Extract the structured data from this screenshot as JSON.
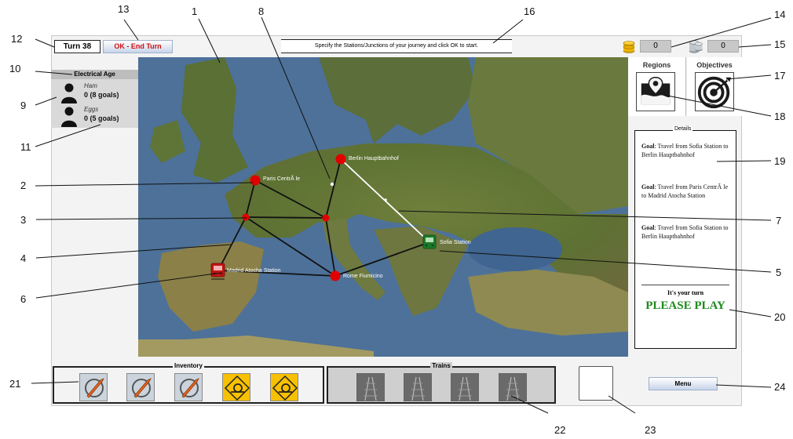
{
  "header": {
    "turn": "Turn 38",
    "end_turn_label": "OK - End Turn",
    "instruction": "Specify the Stations/Junctions of your journey and click OK to start.",
    "coins": "0",
    "tokens": "0"
  },
  "players_panel": {
    "age": "Electrical Age",
    "players": [
      {
        "name": "Ham",
        "score": "0 (8 goals)"
      },
      {
        "name": "Eggs",
        "score": "0 (5 goals)"
      }
    ]
  },
  "map": {
    "stations": [
      {
        "label": "Berlin Hauptbahnhof"
      },
      {
        "label": "Paris CentrÃ le"
      },
      {
        "label": "Sofia Station"
      },
      {
        "label": "Madrid Atocha Station"
      },
      {
        "label": "Rome Fiumicino"
      }
    ]
  },
  "tiles": {
    "regions": "Regions",
    "objectives": "Objectives"
  },
  "details": {
    "title": "Details",
    "goals": [
      {
        "prefix": "Goal",
        "text": ": Travel from Sofia Station to Berlin Hauptbahnhof"
      },
      {
        "prefix": "Goal",
        "text": ": Travel from Paris CentrÃ le to Madrid Atocha Station"
      },
      {
        "prefix": "Goal",
        "text": ": Travel from Sofia Station to Berlin Hauptbahnhof"
      }
    ],
    "turn_text": "It's your turn",
    "play_text": "PLEASE PLAY"
  },
  "bottom": {
    "inventory_title": "Inventory",
    "trains_title": "Trains",
    "menu_label": "Menu"
  },
  "callouts": [
    "1",
    "2",
    "3",
    "4",
    "5",
    "6",
    "7",
    "8",
    "9",
    "10",
    "11",
    "12",
    "13",
    "14",
    "15",
    "16",
    "17",
    "18",
    "19",
    "20",
    "21",
    "22",
    "23",
    "24"
  ],
  "colors": {
    "end_turn_text": "#d01010",
    "play_text": "#1c8a1c",
    "station": "#e00000",
    "route_black": "#111111",
    "route_white": "#ffffff"
  }
}
